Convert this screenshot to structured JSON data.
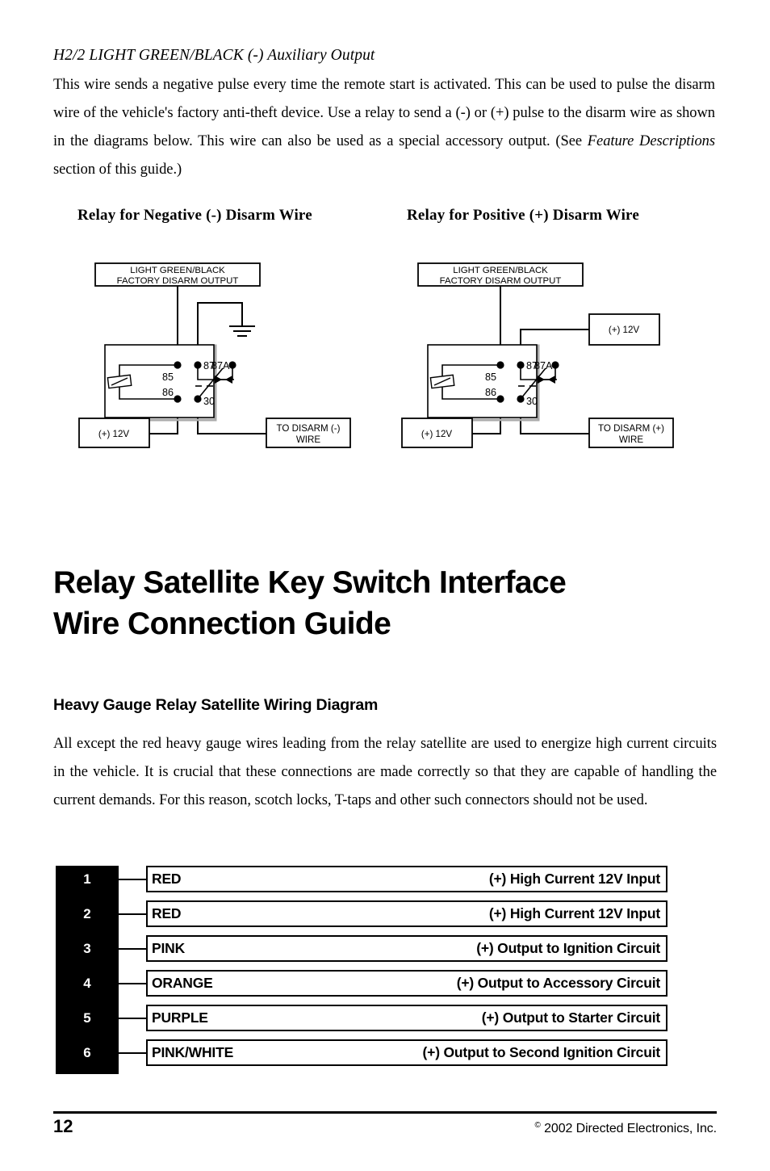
{
  "top_section": {
    "heading": "H2/2 LIGHT GREEN/BLACK (-) Auxiliary Output",
    "paragraph_part1": "This wire sends a negative pulse every time the remote start is activated. This can be used to pulse the disarm wire of the vehicle's factory anti-theft device. Use a relay to send a (-) or (+) pulse to the disarm wire as shown in the diagrams below. This wire can also be used as a special accessory output. (See ",
    "paragraph_italic": "Feature Descriptions",
    "paragraph_part2": " section of this guide.)"
  },
  "diagrams": {
    "left": {
      "heading": "Relay for Negative (-) Disarm Wire",
      "source_box_line1": "LIGHT GREEN/BLACK",
      "source_box_line2": "FACTORY DISARM OUTPUT",
      "power_box": "(+) 12V",
      "output_box_line1": "TO DISARM (-)",
      "output_box_line2": "WIRE",
      "pins": {
        "p85": "85",
        "p86": "86",
        "p87": "87",
        "p87a": "87A",
        "p30": "30"
      },
      "ground_symbol": "earth-ground"
    },
    "right": {
      "heading": "Relay for Positive (+) Disarm Wire",
      "source_box_line1": "LIGHT GREEN/BLACK",
      "source_box_line2": "FACTORY DISARM OUTPUT",
      "power_box_top": "(+) 12V",
      "power_box": "(+) 12V",
      "output_box_line1": "TO DISARM (+)",
      "output_box_line2": "WIRE",
      "pins": {
        "p85": "85",
        "p86": "86",
        "p87": "87",
        "p87a": "87A",
        "p30": "30"
      }
    }
  },
  "main": {
    "title_line1": "Relay Satellite Key Switch Interface",
    "title_line2": "Wire Connection Guide",
    "sub_heading": "Heavy Gauge Relay Satellite Wiring Diagram",
    "paragraph": "All except the red heavy gauge wires leading from the relay satellite are used to energize high current circuits in the vehicle. It is crucial that these connections are made correctly so that they are capable of handling the current demands. For this reason, scotch locks, T-taps and other such connectors should not be used."
  },
  "wire_table": {
    "rows": [
      {
        "number": "1",
        "color": "RED",
        "description": "(+) High Current 12V Input"
      },
      {
        "number": "2",
        "color": "RED",
        "description": "(+) High Current 12V Input"
      },
      {
        "number": "3",
        "color": "PINK",
        "description": "(+) Output to Ignition Circuit"
      },
      {
        "number": "4",
        "color": "ORANGE",
        "description": "(+) Output to Accessory Circuit"
      },
      {
        "number": "5",
        "color": "PURPLE",
        "description": "(+) Output to Starter Circuit"
      },
      {
        "number": "6",
        "color": "PINK/WHITE",
        "description": "(+) Output to Second Ignition Circuit"
      }
    ]
  },
  "footer": {
    "page_number": "12",
    "copyright_symbol": "©",
    "copyright_text": " 2002 Directed Electronics, Inc."
  },
  "colors": {
    "ink": "#000000",
    "paper": "#ffffff",
    "relay_shadow": "#aaaaaa"
  }
}
